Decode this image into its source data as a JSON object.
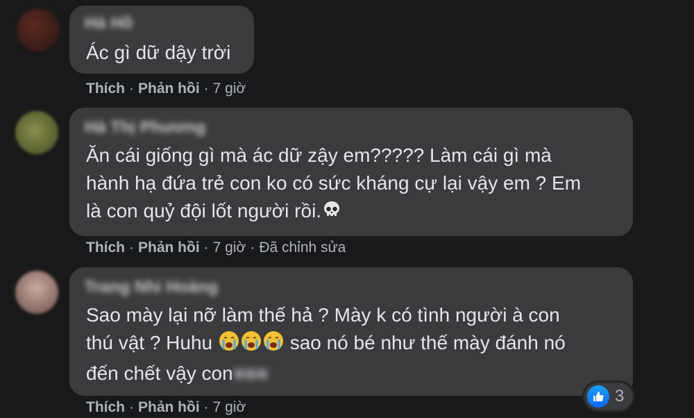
{
  "comments": [
    {
      "author": "Hà Hồ",
      "text_lines": [
        "Ác gì dữ dậy trời"
      ],
      "actions": {
        "like": "Thích",
        "reply": "Phản hồi",
        "time": "7 giờ"
      }
    },
    {
      "author": "Hà Thị Phương",
      "text_lines": [
        "Ăn cái giống gì mà ác dữ zậy em????? Làm cái gì mà",
        "hành hạ đứa trẻ con ko có sức kháng cự lại vậy em ? Em",
        "là con quỷ đội lốt người rồi."
      ],
      "emoji": "skull-icon",
      "actions": {
        "like": "Thích",
        "reply": "Phản hồi",
        "time": "7 giờ",
        "edited": "Đã chỉnh sửa"
      }
    },
    {
      "author": "Trang Nhi Hoàng",
      "text_lines": [
        "Sao mày lại nỡ làm thế hả ? Mày k có tình người à con",
        "thú vật ? Huhu",
        "sao nó bé như thế mày đánh nó",
        "đến chết vậy con"
      ],
      "line2_emojis": [
        "loudly-crying-face-icon",
        "loudly-crying-face-icon",
        "loudly-crying-face-icon"
      ],
      "actions": {
        "like": "Thích",
        "reply": "Phản hồi",
        "time": "7 giờ"
      },
      "reaction": {
        "icon": "like-icon",
        "count": "3"
      }
    }
  ],
  "colors": {
    "background": "#18191a",
    "bubble": "#3a3b3c",
    "text": "#e4e6eb",
    "meta": "#b0b3b8",
    "like_blue": "#0866ff"
  }
}
